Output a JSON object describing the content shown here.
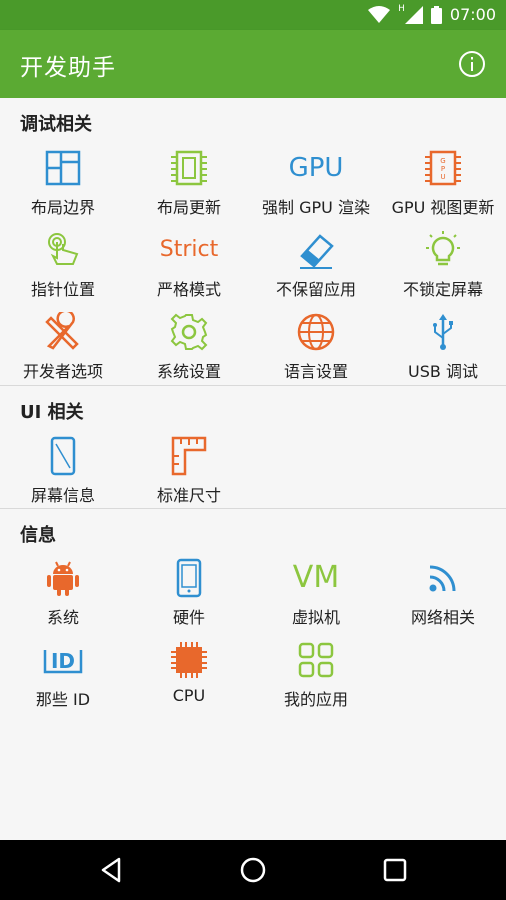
{
  "status": {
    "time": "07:00",
    "network": "H"
  },
  "app": {
    "title": "开发助手"
  },
  "sections": {
    "debug": {
      "title": "调试相关",
      "items": [
        "布局边界",
        "布局更新",
        "强制 GPU 渲染",
        "GPU 视图更新",
        "指针位置",
        "严格模式",
        "不保留应用",
        "不锁定屏幕",
        "开发者选项",
        "系统设置",
        "语言设置",
        "USB 调试"
      ]
    },
    "ui": {
      "title": "UI 相关",
      "items": [
        "屏幕信息",
        "标准尺寸"
      ]
    },
    "info": {
      "title": "信息",
      "items": [
        "系统",
        "硬件",
        "虚拟机",
        "网络相关",
        "那些 ID",
        "CPU",
        "我的应用"
      ]
    }
  },
  "icon_text": {
    "gpu": "GPU",
    "strict": "Strict",
    "vm": "VM"
  },
  "colors": {
    "statusbar": "#4a9a2a",
    "appbar": "#5baa33",
    "blue": "#2f8fd0",
    "green": "#8cc63f",
    "orange": "#e8682c"
  }
}
